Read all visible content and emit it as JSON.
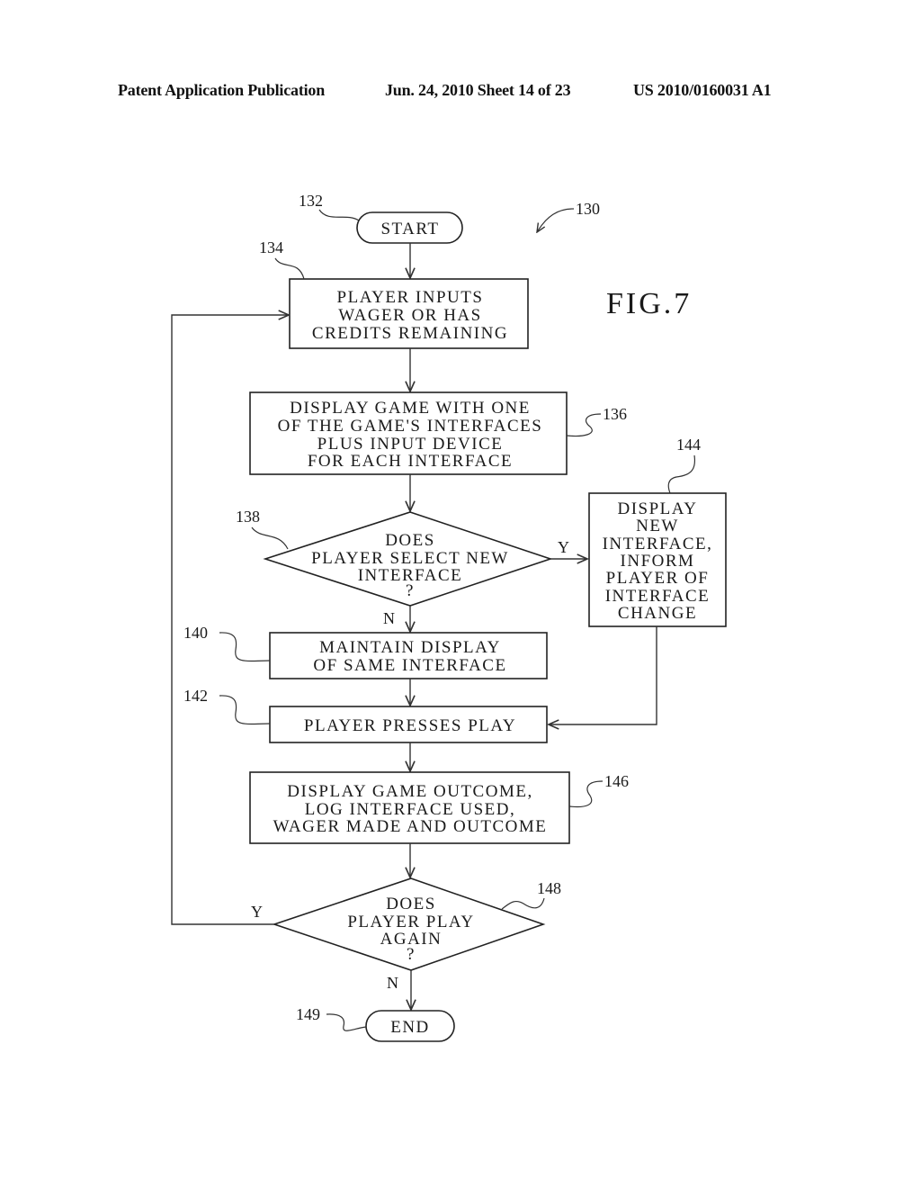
{
  "header": {
    "publication": "Patent Application Publication",
    "date_sheet": "Jun. 24, 2010  Sheet 14 of 23",
    "number": "US 2010/0160031 A1"
  },
  "figure": {
    "label": "FIG.7",
    "ref": "130"
  },
  "nodes": {
    "start": {
      "ref": "132",
      "lines": [
        "START"
      ]
    },
    "wager": {
      "ref": "134",
      "lines": [
        "PLAYER INPUTS",
        "WAGER OR HAS",
        "CREDITS REMAINING"
      ]
    },
    "display": {
      "ref": "136",
      "lines": [
        "DISPLAY GAME WITH ONE",
        "OF THE GAME'S INTERFACES",
        "PLUS INPUT DEVICE",
        "FOR EACH INTERFACE"
      ]
    },
    "select": {
      "ref": "138",
      "lines": [
        "DOES",
        "PLAYER SELECT NEW",
        "INTERFACE",
        "?"
      ]
    },
    "maintain": {
      "ref": "140",
      "lines": [
        "MAINTAIN DISPLAY",
        "OF SAME INTERFACE"
      ]
    },
    "press": {
      "ref": "142",
      "lines": [
        "PLAYER PRESSES PLAY"
      ]
    },
    "newif": {
      "ref": "144",
      "lines": [
        "DISPLAY",
        "NEW",
        "INTERFACE,",
        "INFORM",
        "PLAYER OF",
        "INTERFACE",
        "CHANGE"
      ]
    },
    "outcome": {
      "ref": "146",
      "lines": [
        "DISPLAY GAME OUTCOME,",
        "LOG INTERFACE USED,",
        "WAGER MADE AND OUTCOME"
      ]
    },
    "again": {
      "ref": "148",
      "lines": [
        "DOES",
        "PLAYER PLAY",
        "AGAIN",
        "?"
      ]
    },
    "end": {
      "ref": "149",
      "lines": [
        "END"
      ]
    }
  },
  "edge_labels": {
    "select_yes": "Y",
    "select_no": "N",
    "again_yes": "Y",
    "again_no": "N"
  }
}
